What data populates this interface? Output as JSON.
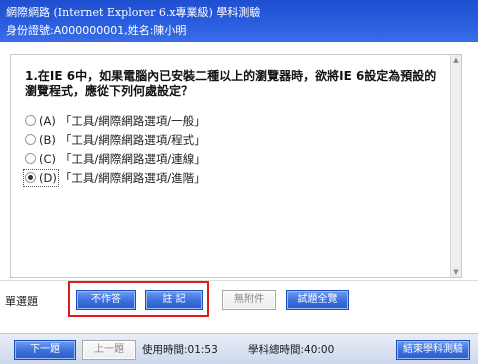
{
  "header": {
    "title": "網際網路 (Internet Explorer 6.x專業級) 學科測驗",
    "examinee": "身份證號:A000000001,姓名:陳小明"
  },
  "question": {
    "text": "1.在IE 6中，如果電腦內已安裝二種以上的瀏覽器時，欲將IE 6設定為預設的瀏覽程式，應從下列何處設定？",
    "options": [
      {
        "key": "(A)",
        "text": "「工具/網際網路選項/一般」",
        "selected": false
      },
      {
        "key": "(B)",
        "text": "「工具/網際網路選項/程式」",
        "selected": false
      },
      {
        "key": "(C)",
        "text": "「工具/網際網路選項/連線」",
        "selected": false
      },
      {
        "key": "(D)",
        "text": "「工具/網際網路選項/進階」",
        "selected": true
      }
    ]
  },
  "question_type": "單選題",
  "buttons": {
    "skip": "不作答",
    "mark": "註 記",
    "attachment": "無附件",
    "overview": "試題全覽"
  },
  "footer": {
    "next": "下一題",
    "prev": "上一題",
    "time_used": "使用時間:01:53",
    "total_time": "學科總時間:40:00",
    "end": "結束學科測驗"
  },
  "colors": {
    "header_blue": "#2a5fe0",
    "button_blue": "#3a6fdc",
    "highlight_red": "#e01b1b"
  }
}
